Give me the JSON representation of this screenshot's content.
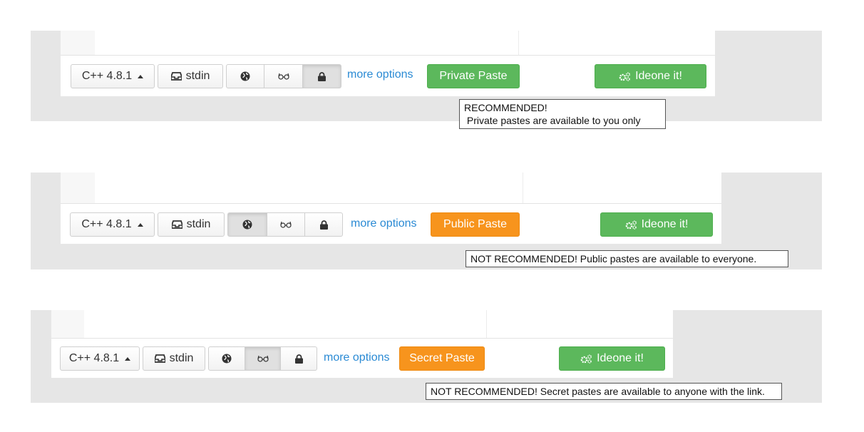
{
  "colors": {
    "accent_green": "#5cb85c",
    "accent_orange": "#f7941d",
    "link_blue": "#2a8ad4",
    "panel_gray": "#e6e6e6"
  },
  "panels": [
    {
      "language_label": "C++ 4.8.1",
      "stdin_label": "stdin",
      "visibility_icons": [
        "globe-icon",
        "glasses-icon",
        "lock-icon"
      ],
      "active_visibility": "lock",
      "more_options": "more options",
      "paste_label": "Private Paste",
      "paste_color": "green",
      "ideone_label": "Ideone it!",
      "tooltip_lines": [
        "RECOMMENDED!",
        " Private pastes are available to you only"
      ]
    },
    {
      "language_label": "C++ 4.8.1",
      "stdin_label": "stdin",
      "visibility_icons": [
        "globe-icon",
        "glasses-icon",
        "lock-icon"
      ],
      "active_visibility": "globe",
      "more_options": "more options",
      "paste_label": "Public Paste",
      "paste_color": "orange",
      "ideone_label": "Ideone it!",
      "tooltip_lines": [
        "NOT RECOMMENDED! Public pastes are available to everyone."
      ]
    },
    {
      "language_label": "C++ 4.8.1",
      "stdin_label": "stdin",
      "visibility_icons": [
        "globe-icon",
        "glasses-icon",
        "lock-icon"
      ],
      "active_visibility": "glasses",
      "more_options": "more options",
      "paste_label": "Secret Paste",
      "paste_color": "orange",
      "ideone_label": "Ideone it!",
      "tooltip_lines": [
        "NOT RECOMMENDED! Secret pastes are available to anyone with the link."
      ]
    }
  ]
}
